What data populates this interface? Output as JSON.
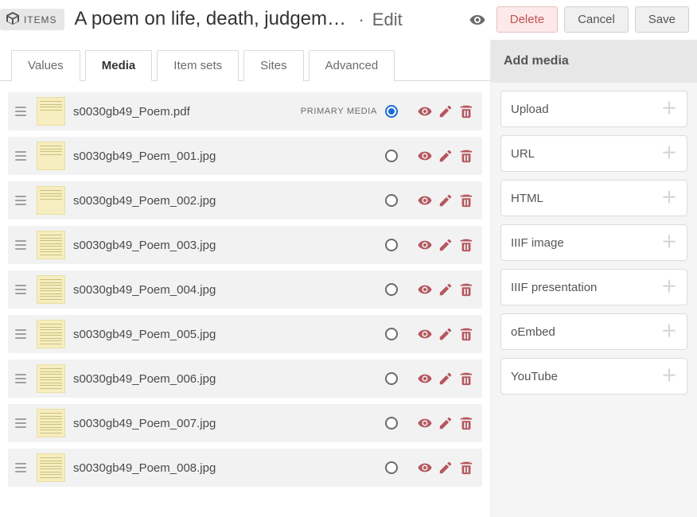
{
  "header": {
    "breadcrumb_label": "ITEMS",
    "title": "A poem on life, death, judgeme…",
    "mode": "Edit",
    "delete": "Delete",
    "cancel": "Cancel",
    "save": "Save"
  },
  "tabs": [
    {
      "label": "Values",
      "active": false
    },
    {
      "label": "Media",
      "active": true
    },
    {
      "label": "Item sets",
      "active": false
    },
    {
      "label": "Sites",
      "active": false
    },
    {
      "label": "Advanced",
      "active": false
    }
  ],
  "primary_media_label": "PRIMARY MEDIA",
  "media": [
    {
      "filename": "s0030gb49_Poem.pdf",
      "primary": true,
      "sparse": true
    },
    {
      "filename": "s0030gb49_Poem_001.jpg",
      "primary": false,
      "sparse": true
    },
    {
      "filename": "s0030gb49_Poem_002.jpg",
      "primary": false,
      "sparse": true
    },
    {
      "filename": "s0030gb49_Poem_003.jpg",
      "primary": false,
      "sparse": false
    },
    {
      "filename": "s0030gb49_Poem_004.jpg",
      "primary": false,
      "sparse": false
    },
    {
      "filename": "s0030gb49_Poem_005.jpg",
      "primary": false,
      "sparse": false
    },
    {
      "filename": "s0030gb49_Poem_006.jpg",
      "primary": false,
      "sparse": false
    },
    {
      "filename": "s0030gb49_Poem_007.jpg",
      "primary": false,
      "sparse": false
    },
    {
      "filename": "s0030gb49_Poem_008.jpg",
      "primary": false,
      "sparse": false
    }
  ],
  "sidebar": {
    "heading": "Add media",
    "options": [
      {
        "label": "Upload"
      },
      {
        "label": "URL"
      },
      {
        "label": "HTML"
      },
      {
        "label": "IIIF image"
      },
      {
        "label": "IIIF presentation"
      },
      {
        "label": "oEmbed"
      },
      {
        "label": "YouTube"
      }
    ]
  }
}
